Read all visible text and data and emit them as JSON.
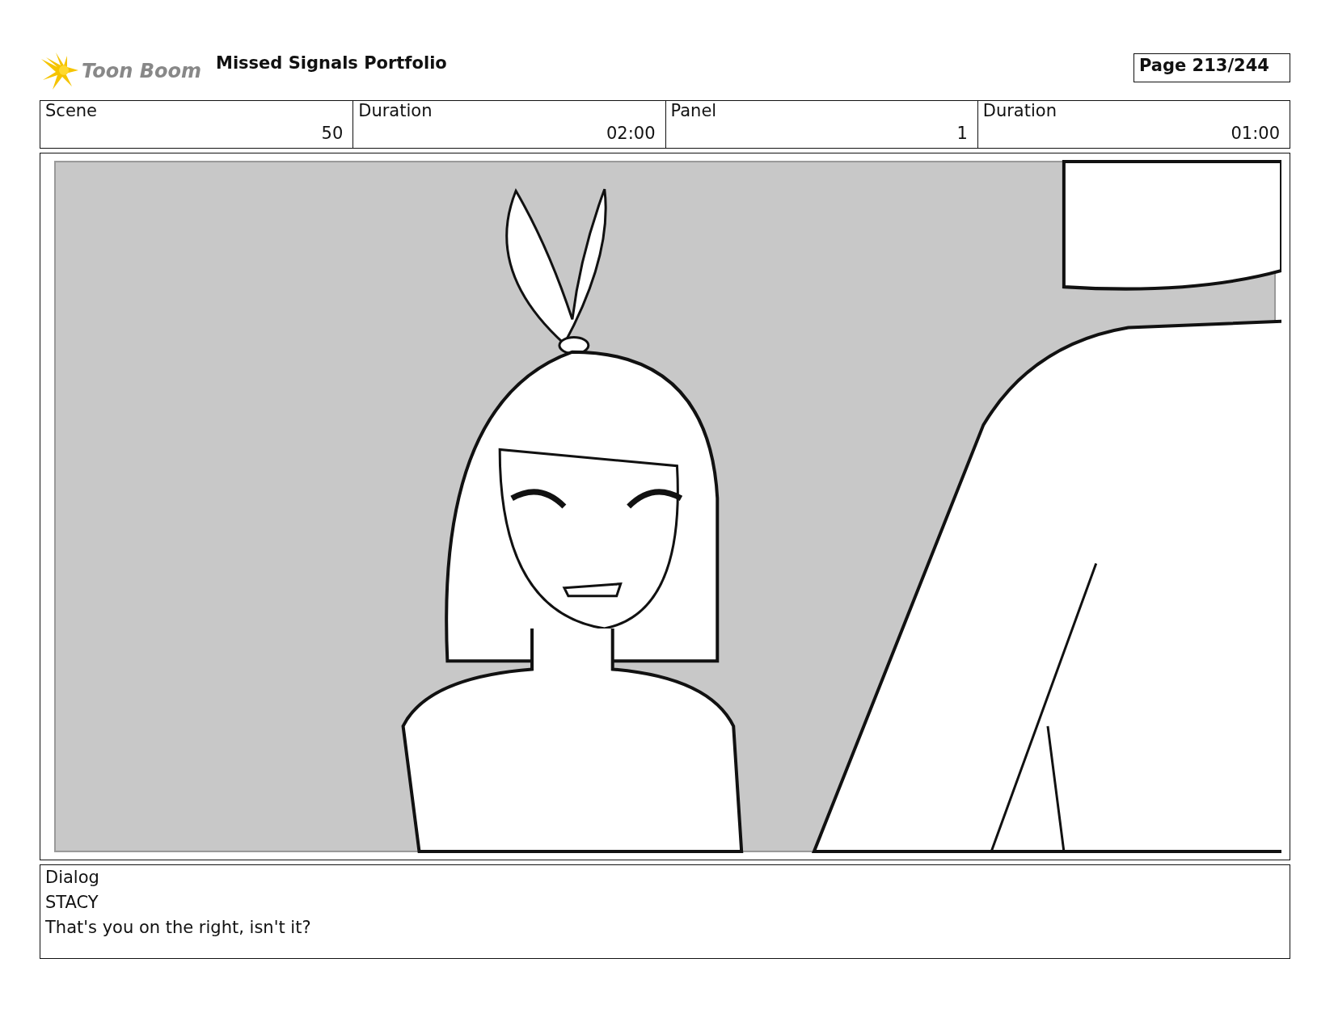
{
  "header": {
    "logo_text": "Toon Boom",
    "title": "Missed Signals Portfolio",
    "page": "Page 213/244"
  },
  "info_fields": [
    {
      "label": "Scene",
      "value": "50"
    },
    {
      "label": "Duration",
      "value": "02:00"
    },
    {
      "label": "Panel",
      "value": "1"
    },
    {
      "label": "Duration",
      "value": "01:00"
    }
  ],
  "dialog": {
    "label": "Dialog",
    "lines": [
      "STACY",
      "That's you on the right, isn't it?"
    ]
  }
}
